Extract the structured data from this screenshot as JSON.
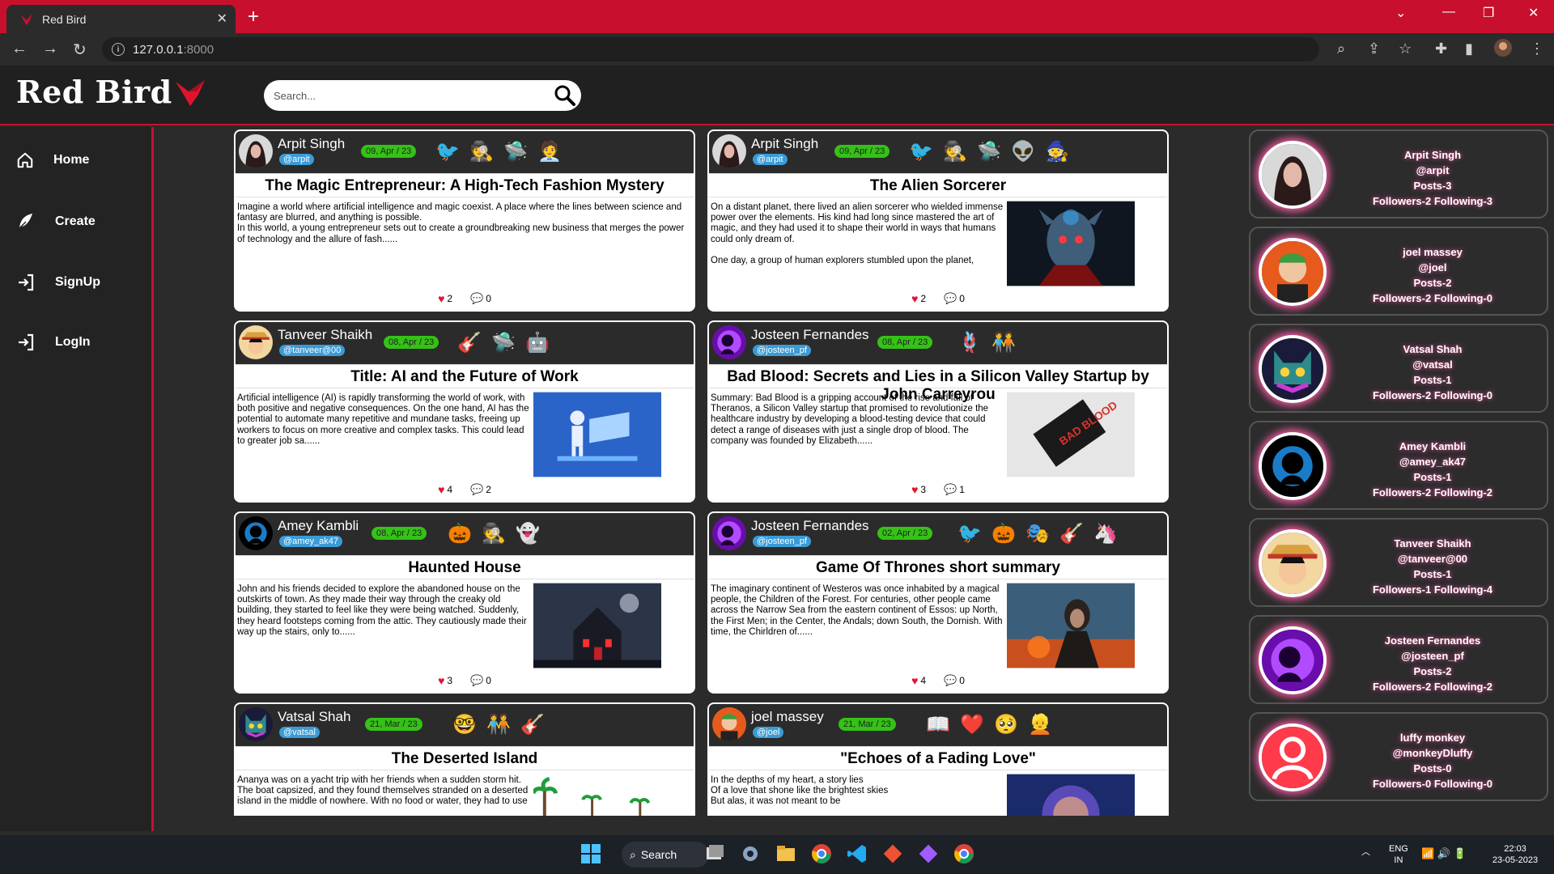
{
  "browser": {
    "tab_title": "Red Bird",
    "url_host": "127.0.0.1",
    "url_port": ":8000"
  },
  "app": {
    "brand": "Red Bird",
    "brand_color": "#c8102e",
    "search_placeholder": "Search..."
  },
  "sidebar": {
    "items": [
      {
        "label": "Home",
        "icon": "home-icon"
      },
      {
        "label": "Create",
        "icon": "feather-icon"
      },
      {
        "label": "SignUp",
        "icon": "login-arrow-icon"
      },
      {
        "label": "LogIn",
        "icon": "login-arrow-icon"
      }
    ]
  },
  "posts": [
    {
      "author": "Arpit Singh",
      "handle": "@arpit",
      "date": "09, Apr / 23",
      "tags": [
        "🐦",
        "🕵️",
        "🛸",
        "🧑‍💼"
      ],
      "title": "The Magic Entrepreneur: A High-Tech Fashion Mystery",
      "text": "Imagine a world where artificial intelligence and magic coexist. A place where the lines between science and fantasy are blurred, and anything is possible.\nIn this world, a young entrepreneur sets out to create a groundbreaking new business that merges the power of technology and the allure of fash......",
      "likes": "2",
      "comments": "0",
      "image": ""
    },
    {
      "author": "Arpit Singh",
      "handle": "@arpit",
      "date": "09, Apr / 23",
      "tags": [
        "🐦",
        "🕵️",
        "🛸",
        "👽",
        "🧙"
      ],
      "title": "The Alien Sorcerer",
      "text": "On a distant planet, there lived an alien sorcerer who wielded immense power over the elements. His kind had long since mastered the art of magic, and they had used it to shape their world in ways that humans could only dream of.\n\nOne day, a group of human explorers stumbled upon the planet,",
      "likes": "2",
      "comments": "0",
      "image": "alien"
    },
    {
      "author": "Tanveer Shaikh",
      "handle": "@tanveer@00",
      "date": "08, Apr / 23",
      "tags": [
        "🎸",
        "🛸",
        "🤖"
      ],
      "title": "Title: AI and the Future of Work",
      "text": "Artificial intelligence (AI) is rapidly transforming the world of work, with both positive and negative consequences. On the one hand, AI has the potential to automate many repetitive and mundane tasks, freeing up workers to focus on more creative and complex tasks. This could lead to greater job sa......",
      "likes": "4",
      "comments": "2",
      "image": "ai"
    },
    {
      "author": "Josteen Fernandes",
      "handle": "@josteen_pf",
      "date": "08, Apr / 23",
      "tags": [
        "🪢",
        "🧑‍🤝‍🧑"
      ],
      "title": "Bad Blood: Secrets and Lies in a Silicon Valley Startup by John Carreyrou",
      "text": "Summary: Bad Blood is a gripping account of the rise and fall of Theranos, a Silicon Valley startup that promised to revolutionize the healthcare industry by developing a blood-testing device that could detect a range of diseases with just a single drop of blood. The company was founded by Elizabeth......",
      "likes": "3",
      "comments": "1",
      "image": "book"
    },
    {
      "author": "Amey Kambli",
      "handle": "@amey_ak47",
      "date": "08, Apr / 23",
      "tags": [
        "🎃",
        "🕵️",
        "👻"
      ],
      "title": "Haunted House",
      "text": "John and his friends decided to explore the abandoned house on the outskirts of town. As they made their way through the creaky old building, they started to feel like they were being watched. Suddenly, they heard footsteps coming from the attic. They cautiously made their way up the stairs, only to......",
      "likes": "3",
      "comments": "0",
      "image": "house"
    },
    {
      "author": "Josteen Fernandes",
      "handle": "@josteen_pf",
      "date": "02, Apr / 23",
      "tags": [
        "🐦",
        "🎃",
        "🎭",
        "🎸",
        "🦄"
      ],
      "title": "Game Of Thrones short summary",
      "text": "The imaginary continent of Westeros was once inhabited by a magical people, the Children of the Forest. For centuries, other people came across the Narrow Sea from the eastern continent of Essos: up North, the First Men; in the Center, the Andals; down South, the Dornish. With time, the Chirldren of......",
      "likes": "4",
      "comments": "0",
      "image": "got"
    },
    {
      "author": "Vatsal Shah",
      "handle": "@vatsal",
      "date": "21, Mar / 23",
      "tags": [
        "🤓",
        "🧑‍🤝‍🧑",
        "🎸"
      ],
      "title": "The Deserted Island",
      "text": "Ananya was on a yacht trip with her friends when a sudden storm hit. The boat capsized, and they found themselves stranded on a deserted island in the middle of nowhere. With no food or water, they had to use",
      "likes": "",
      "comments": "",
      "image": "island"
    },
    {
      "author": "joel massey",
      "handle": "@joel",
      "date": "21, Mar / 23",
      "tags": [
        "📖",
        "❤️",
        "🥺",
        "👱"
      ],
      "title": "\"Echoes of a Fading Love\"",
      "text": "In the depths of my heart, a story lies\nOf a love that shone like the brightest skies\nBut alas, it was not meant to be",
      "likes": "",
      "comments": "",
      "image": "love"
    }
  ],
  "users": [
    {
      "name": "Arpit Singh",
      "handle": "@arpit",
      "posts": "Posts-3",
      "follow": "Followers-2 Following-3",
      "avatar": "girl"
    },
    {
      "name": "joel massey",
      "handle": "@joel",
      "posts": "Posts-2",
      "follow": "Followers-2 Following-0",
      "avatar": "zoro"
    },
    {
      "name": "Vatsal Shah",
      "handle": "@vatsal",
      "posts": "Posts-1",
      "follow": "Followers-2 Following-0",
      "avatar": "cat"
    },
    {
      "name": "Amey Kambli",
      "handle": "@amey_ak47",
      "posts": "Posts-1",
      "follow": "Followers-2 Following-2",
      "avatar": "dark"
    },
    {
      "name": "Tanveer Shaikh",
      "handle": "@tanveer@00",
      "posts": "Posts-1",
      "follow": "Followers-1 Following-4",
      "avatar": "luffy"
    },
    {
      "name": "Josteen Fernandes",
      "handle": "@josteen_pf",
      "posts": "Posts-2",
      "follow": "Followers-2 Following-2",
      "avatar": "purple"
    },
    {
      "name": "luffy monkey",
      "handle": "@monkeyDluffy",
      "posts": "Posts-0",
      "follow": "Followers-0 Following-0",
      "avatar": "default"
    }
  ],
  "taskbar": {
    "search_label": "Search",
    "lang_top": "ENG",
    "lang_bottom": "IN",
    "time": "22:03",
    "date": "23-05-2023"
  }
}
